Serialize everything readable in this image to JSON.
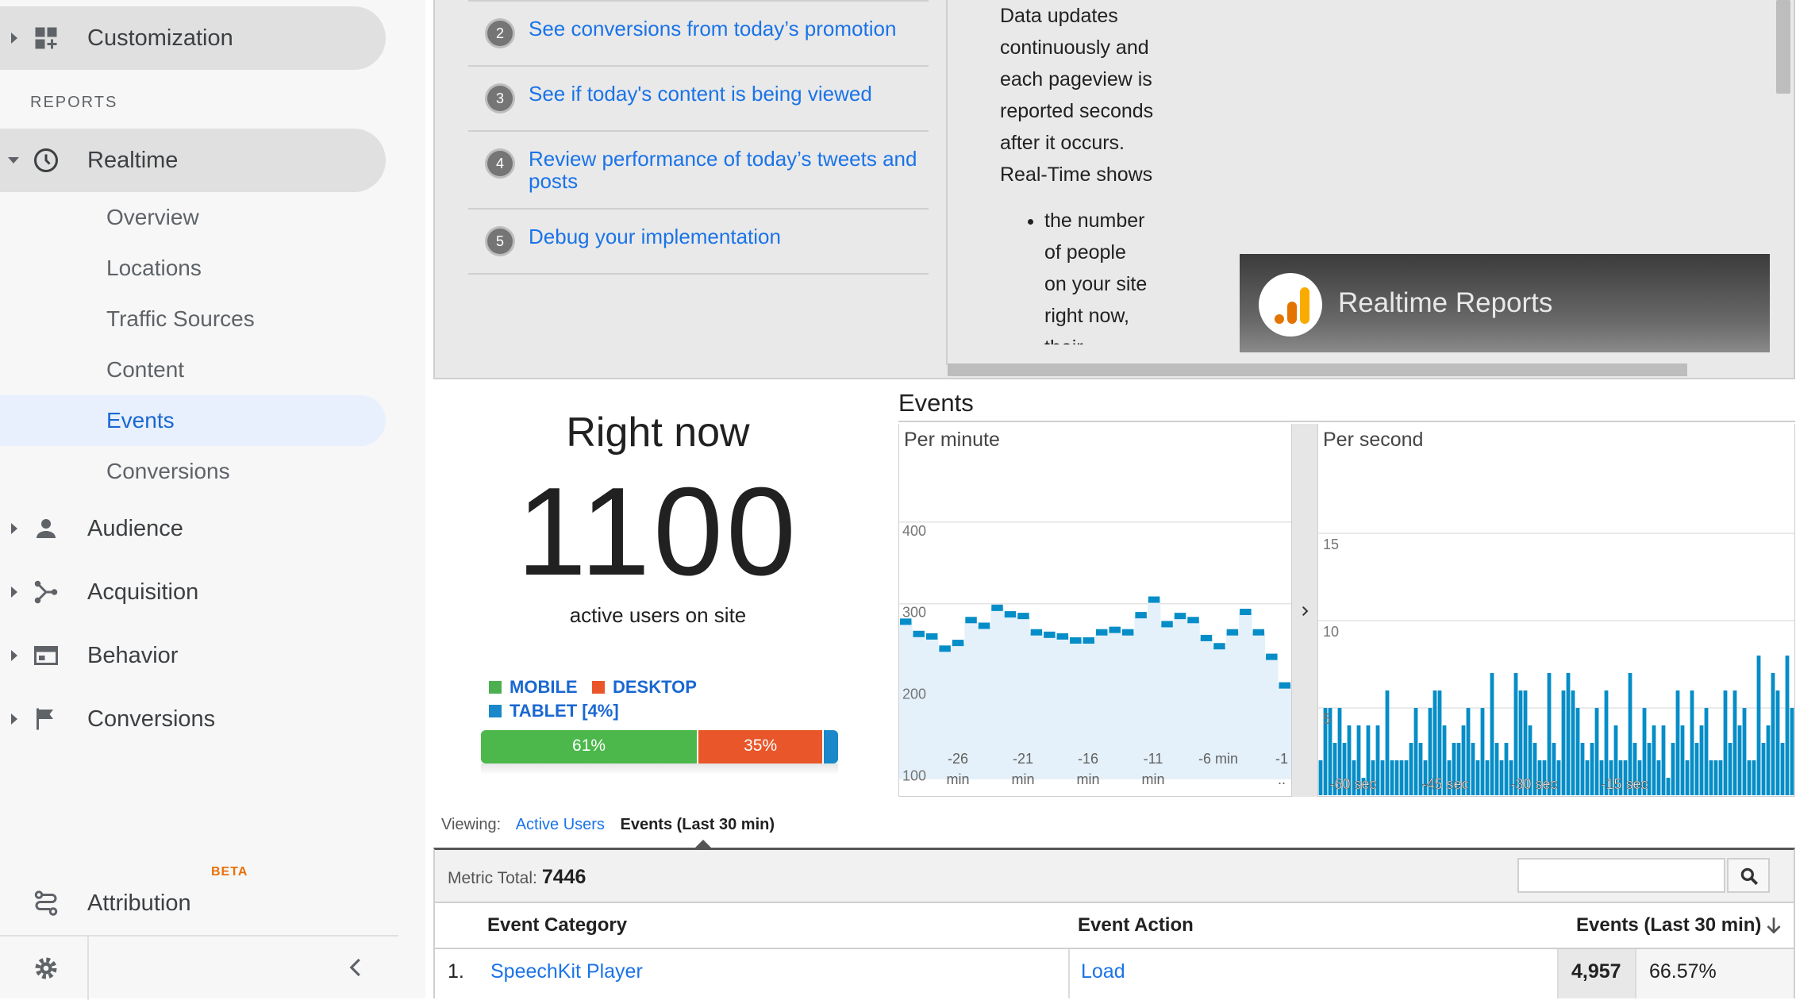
{
  "sidebar": {
    "customization_label": "Customization",
    "reports_header": "REPORTS",
    "realtime_label": "Realtime",
    "realtime_items": [
      {
        "label": "Overview"
      },
      {
        "label": "Locations"
      },
      {
        "label": "Traffic Sources"
      },
      {
        "label": "Content"
      },
      {
        "label": "Events",
        "active": true
      },
      {
        "label": "Conversions"
      }
    ],
    "audience_label": "Audience",
    "acquisition_label": "Acquisition",
    "behavior_label": "Behavior",
    "conversions_label": "Conversions",
    "attribution_label": "Attribution",
    "attribution_badge": "BETA",
    "icons": [
      "dashboard-add-icon",
      "clock-icon",
      "person-icon",
      "acquisition-icon",
      "behavior-icon",
      "flag-icon",
      "attribution-icon",
      "gear-icon",
      "chevron-left-icon"
    ]
  },
  "video_panel": {
    "steps": [
      {
        "num": "2",
        "text": "See conversions from today’s promotion"
      },
      {
        "num": "3",
        "text": "See if today's content is being viewed"
      },
      {
        "num": "4",
        "text": "Review performance of today’s tweets and posts"
      },
      {
        "num": "5",
        "text": "Debug your implementation"
      }
    ],
    "description_lines": [
      "Data updates",
      "continuously and",
      "each pageview is",
      "reported seconds",
      "after it occurs.",
      "Real-Time shows"
    ],
    "bullet_lines": [
      "the number",
      "of people",
      "on your site",
      "right now,"
    ],
    "bullet_cutoff": "their",
    "video_title": "Realtime Reports"
  },
  "right_now": {
    "title": "Right now",
    "count": "1100",
    "subtitle": "active users on site",
    "legend": [
      {
        "label": "MOBILE",
        "color": "#4caf50"
      },
      {
        "label": "DESKTOP",
        "color": "#e8562a"
      },
      {
        "label": "TABLET [4%]",
        "color": "#1a88c9"
      }
    ],
    "device_split": [
      {
        "label": "61%",
        "value": 61,
        "color": "#4cb84c"
      },
      {
        "label": "35%",
        "value": 35,
        "color": "#e8562a"
      },
      {
        "label": "",
        "value": 4,
        "color": "#1a88c9"
      }
    ]
  },
  "events": {
    "title": "Events",
    "per_minute_label": "Per minute",
    "per_second_label": "Per second"
  },
  "chart_data": [
    {
      "type": "area",
      "title": "Per minute",
      "y_ticks": [
        "400",
        "300",
        "200",
        "100"
      ],
      "x_ticks": [
        [
          "-26",
          "min"
        ],
        [
          "-21",
          "min"
        ],
        [
          "-16",
          "min"
        ],
        [
          "-11",
          "min"
        ],
        [
          "-6 min",
          ""
        ],
        [
          "-1",
          ".."
        ]
      ],
      "x": [
        -30,
        -29,
        -28,
        -27,
        -26,
        -25,
        -24,
        -23,
        -22,
        -21,
        -20,
        -19,
        -18,
        -17,
        -16,
        -15,
        -14,
        -13,
        -12,
        -11,
        -10,
        -9,
        -8,
        -7,
        -6,
        -5,
        -4,
        -3,
        -2,
        -1
      ],
      "values": [
        278,
        263,
        260,
        245,
        252,
        280,
        273,
        295,
        287,
        285,
        265,
        262,
        260,
        255,
        255,
        265,
        268,
        265,
        286,
        305,
        275,
        285,
        280,
        258,
        248,
        265,
        290,
        265,
        235,
        200
      ],
      "ylim": [
        85,
        460
      ],
      "color": "#058dc7"
    },
    {
      "type": "bar",
      "title": "Per second",
      "y_ticks": [
        "15",
        "10",
        "5"
      ],
      "x_ticks": [
        "-60 sec",
        "-45 sec",
        "-30 sec",
        "-15 sec"
      ],
      "values": [
        2,
        5,
        5,
        3,
        5,
        3,
        4,
        2,
        4,
        1,
        4,
        2,
        4,
        2,
        6,
        2,
        2,
        2,
        2,
        3,
        5,
        3,
        2,
        5,
        6,
        6,
        4,
        2,
        3,
        3,
        4,
        5,
        3,
        2,
        5,
        2,
        7,
        3,
        2,
        3,
        2,
        7,
        6,
        6,
        4,
        3,
        2,
        2,
        7,
        3,
        2,
        6,
        7,
        6,
        5,
        3,
        2,
        3,
        5,
        2,
        6,
        2,
        4,
        2,
        2,
        7,
        3,
        2,
        5,
        3,
        4,
        2,
        4,
        1,
        3,
        6,
        4,
        2,
        6,
        3,
        4,
        5,
        2,
        2,
        2,
        6,
        3,
        6,
        4,
        5,
        2,
        2,
        8,
        3,
        4,
        7,
        6,
        3,
        8,
        5
      ],
      "ylim": [
        0,
        19
      ],
      "color": "#058dc7"
    }
  ],
  "viewing": {
    "label": "Viewing:",
    "link": "Active Users",
    "active": "Events (Last 30 min)"
  },
  "metric": {
    "label": "Metric Total:",
    "value": "7446",
    "search_placeholder": ""
  },
  "table": {
    "headers": [
      "Event Category",
      "Event Action",
      "Events (Last 30 min)"
    ],
    "rows": [
      {
        "index": "1.",
        "category": "SpeechKit Player",
        "action": "Load",
        "events": "4,957",
        "percent": "66.57%"
      }
    ]
  }
}
